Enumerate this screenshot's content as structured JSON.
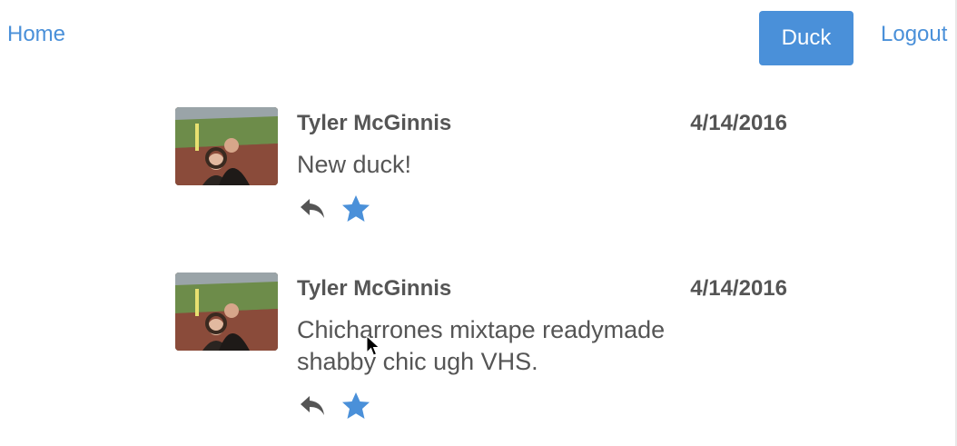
{
  "nav": {
    "home_label": "Home",
    "duck_button_label": "Duck",
    "logout_label": "Logout"
  },
  "colors": {
    "accent": "#4a90d9",
    "text": "#555555",
    "star": "#4a90d9"
  },
  "feed": {
    "ducks": [
      {
        "author": "Tyler McGinnis",
        "date": "4/14/2016",
        "text": "New duck!",
        "avatar_icon": "avatar-photo",
        "reply_icon": "reply-icon",
        "like_icon": "star-icon"
      },
      {
        "author": "Tyler McGinnis",
        "date": "4/14/2016",
        "text": "Chicharrones mixtape readymade shabby chic ugh VHS.",
        "avatar_icon": "avatar-photo",
        "reply_icon": "reply-icon",
        "like_icon": "star-icon"
      }
    ]
  }
}
